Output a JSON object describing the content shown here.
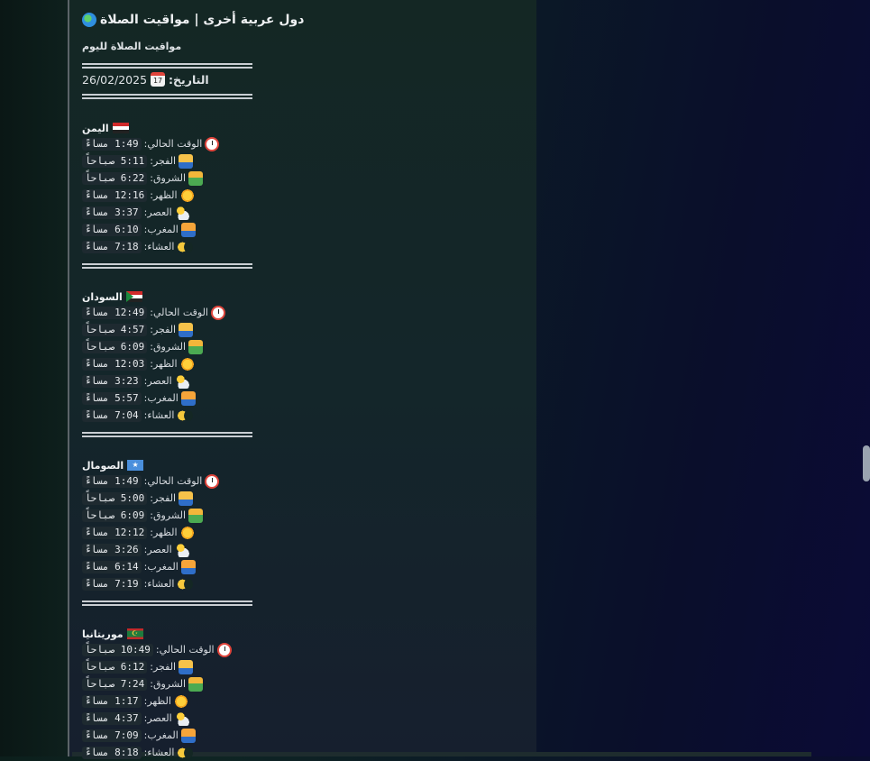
{
  "header": {
    "title": "دول عربية أخرى | مواقيت الصلاة",
    "subtitle": "مواقيت الصلاة لليوم",
    "date_label": "التاريخ:",
    "date_value": "26/02/2025",
    "globe_icon": "globe-icon",
    "calendar_icon": "calendar-icon"
  },
  "labels": {
    "current": "الوقت الحالي:",
    "fajr": "الفجر:",
    "sunrise": "الشروق:",
    "dhuhr": "الظهر:",
    "asr": "العصر:",
    "maghrib": "المغرب:",
    "isha": "العشاء:"
  },
  "countries": [
    {
      "name": "اليمن",
      "flag": "yemen-flag",
      "current": "1:49 مساءً",
      "fajr": "5:11 صباحاً",
      "sunrise": "6:22 صباحاً",
      "dhuhr": "12:16 مساءً",
      "asr": "3:37 مساءً",
      "maghrib": "6:10 مساءً",
      "isha": "7:18 مساءً"
    },
    {
      "name": "السودان",
      "flag": "sudan-flag",
      "current": "12:49 مساءً",
      "fajr": "4:57 صباحاً",
      "sunrise": "6:09 صباحاً",
      "dhuhr": "12:03 مساءً",
      "asr": "3:23 مساءً",
      "maghrib": "5:57 مساءً",
      "isha": "7:04 مساءً"
    },
    {
      "name": "الصومال",
      "flag": "somalia-flag",
      "current": "1:49 مساءً",
      "fajr": "5:00 صباحاً",
      "sunrise": "6:09 صباحاً",
      "dhuhr": "12:12 مساءً",
      "asr": "3:26 مساءً",
      "maghrib": "6:14 مساءً",
      "isha": "7:19 مساءً"
    },
    {
      "name": "موريتانيا",
      "flag": "mauritania-flag",
      "current": "10:49 صباحاً",
      "fajr": "6:12 صباحاً",
      "sunrise": "7:24 صباحاً",
      "dhuhr": "1:17 مساءً",
      "asr": "4:37 مساءً",
      "maghrib": "7:09 مساءً",
      "isha": "8:18 مساءً"
    }
  ]
}
